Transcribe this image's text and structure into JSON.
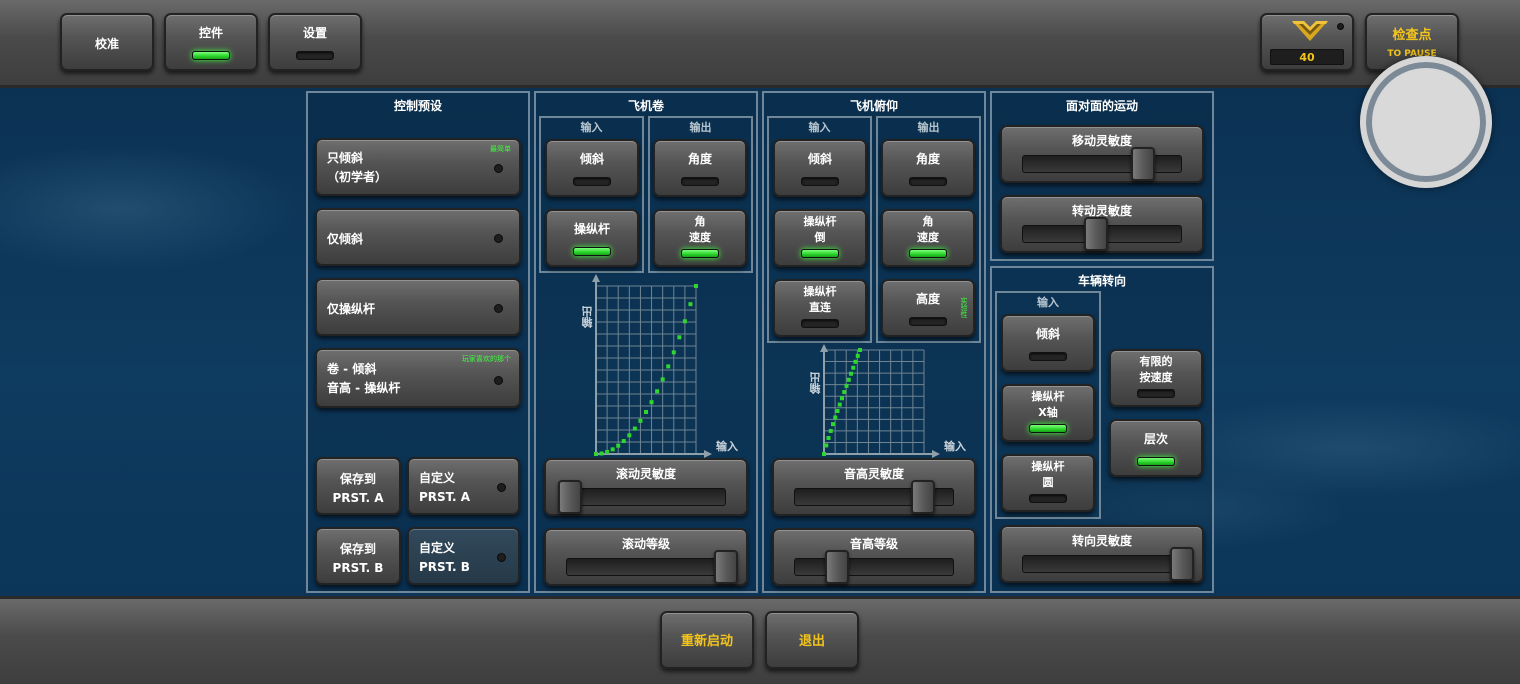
{
  "top_tabs": [
    {
      "label": "校准",
      "led": "none"
    },
    {
      "label": "控件",
      "led": "on"
    },
    {
      "label": "设置",
      "led": "off"
    }
  ],
  "rank": {
    "value": "40",
    "icon": "wings-emblem-icon"
  },
  "checkpoint": {
    "title": "检查点",
    "subtitle": "TO PAUSE"
  },
  "presets": {
    "title": "控制预设",
    "items": [
      {
        "line1": "只倾斜",
        "line2": "（初学者）",
        "tag": "最简单"
      },
      {
        "line1": "仅倾斜",
        "line2": "",
        "tag": ""
      },
      {
        "line1": "仅操纵杆",
        "line2": "",
        "tag": ""
      },
      {
        "line1": "卷 - 倾斜",
        "line2": "音高 - 操纵杆",
        "tag": "玩家喜欢的那个"
      }
    ],
    "save_a": {
      "line1": "保存到",
      "line2": "PRST. A"
    },
    "custom_a": {
      "line1": "自定义",
      "line2": "PRST. A"
    },
    "save_b": {
      "line1": "保存到",
      "line2": "PRST. B"
    },
    "custom_b": {
      "line1": "自定义",
      "line2": "PRST. B"
    }
  },
  "roll": {
    "title": "飞机卷",
    "input_label": "输入",
    "output_label": "输出",
    "tilt": "倾斜",
    "joystick": "操纵杆",
    "angle": "角度",
    "angular_speed_1": "角",
    "angular_speed_2": "速度",
    "graph_x": "输入",
    "graph_y": "输出",
    "sensitivity_label": "滚动灵敏度",
    "sensitivity_value": 0.0,
    "level_label": "滚动等级",
    "level_value": 1.0
  },
  "pitch": {
    "title": "飞机俯仰",
    "input_label": "输入",
    "output_label": "输出",
    "tilt": "倾斜",
    "joystick_inv_1": "操纵杆",
    "joystick_inv_2": "倒",
    "joystick_direct_1": "操纵杆",
    "joystick_direct_2": "直连",
    "angle": "角度",
    "angular_speed_1": "角",
    "angular_speed_2": "速度",
    "altitude": "高度",
    "altitude_tag": "实验性",
    "graph_x": "输入",
    "graph_y": "输出",
    "sensitivity_label": "音高灵敏度",
    "sensitivity_value": 0.8,
    "level_label": "音高等级",
    "level_value": 0.25
  },
  "face": {
    "title": "面对面的运动",
    "move_label": "移动灵敏度",
    "move_value": 0.75,
    "turn_label": "转动灵敏度",
    "turn_value": 0.45
  },
  "steering": {
    "title": "车辆转向",
    "input_label": "输入",
    "tilt": "倾斜",
    "x_axis_1": "操纵杆",
    "x_axis_2": "X轴",
    "circle_1": "操纵杆",
    "circle_2": "圆",
    "limited_1": "有限的",
    "limited_2": "按速度",
    "level": "层次",
    "sensitivity_label": "转向灵敏度",
    "sensitivity_value": 1.0
  },
  "bottom": {
    "restart": "重新启动",
    "exit": "退出"
  },
  "colors": {
    "led_on": "#2ed62f",
    "accent_yellow": "#f2c41c",
    "panel_border": "#6f8798"
  }
}
